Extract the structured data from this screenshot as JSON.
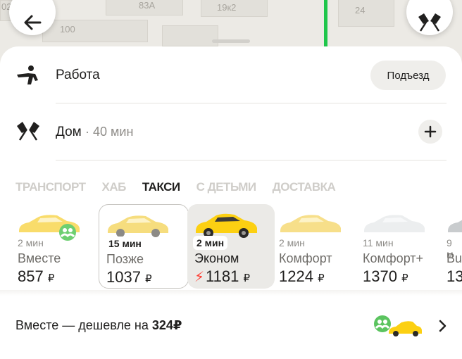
{
  "map": {
    "labels": [
      "02",
      "83A",
      "19к2",
      "100",
      "24"
    ]
  },
  "addresses": {
    "from": {
      "title": "Работа",
      "entrance_label": "Подъезд"
    },
    "to": {
      "title": "Дом",
      "eta": "· 40 мин"
    }
  },
  "tabs": [
    {
      "label": "ТРАНСПОРТ",
      "active": false
    },
    {
      "label": "ХАБ",
      "active": false
    },
    {
      "label": "ТАКСИ",
      "active": true
    },
    {
      "label": "С ДЕТЬМИ",
      "active": false
    },
    {
      "label": "ДОСТАВКА",
      "active": false
    }
  ],
  "tariffs": [
    {
      "eta": "2 мин",
      "name": "Вместе",
      "price": "857",
      "currency": "₽",
      "car_color": "#f9dc6b"
    },
    {
      "eta": "15 мин",
      "name": "Позже",
      "price": "1037",
      "currency": "₽",
      "car_color": "#f6dd7e"
    },
    {
      "eta": "2 мин",
      "name": "Эконом",
      "price": "1181",
      "currency": "₽",
      "car_color": "#fcd012"
    },
    {
      "eta": "2 мин",
      "name": "Комфорт",
      "price": "1224",
      "currency": "₽",
      "car_color": "#f7df8a"
    },
    {
      "eta": "11 мин",
      "name": "Комфорт+",
      "price": "1370",
      "currency": "₽",
      "car_color": "#eceeef"
    },
    {
      "eta": "9 м",
      "name": "Bu",
      "price": "13",
      "currency": "",
      "car_color": "#c9ccce"
    }
  ],
  "promo": {
    "text": "Вместе — дешевле на ",
    "amount": "324₽"
  },
  "colors": {
    "route": "#1fc64b",
    "accent_yellow": "#fcd012",
    "surge": "#ff3b30",
    "together_badge": "#5bc45f"
  },
  "icons": {
    "back": "arrow-left-icon",
    "flags": "checkered-flags-icon",
    "walk": "pedestrian-icon",
    "plus": "plus-icon",
    "surge": "lightning-icon",
    "chevron": "chevron-right-icon"
  }
}
